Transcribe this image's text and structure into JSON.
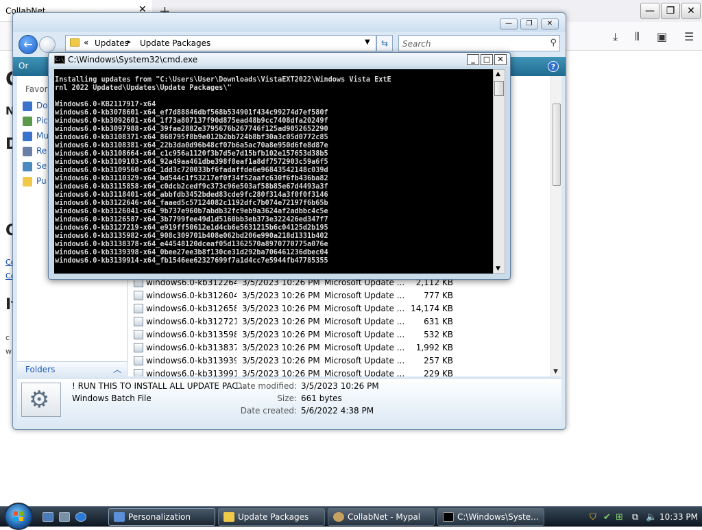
{
  "browser": {
    "tab_title": "CollabNet",
    "tab_close": "✕",
    "new_tab": "+",
    "window_controls": [
      "—",
      "❐",
      "✕"
    ],
    "toolbar_icons": [
      "download-icon",
      "library-icon",
      "sidebar-icon",
      "menu-icon"
    ],
    "page_fragments": [
      "C",
      "N",
      "D",
      "C",
      "It"
    ],
    "page_link_fragments": [
      "Cc",
      "Cc"
    ],
    "page_text_fragments": [
      "c",
      "w"
    ]
  },
  "explorer": {
    "window_controls": [
      "—",
      "❐",
      "✕"
    ],
    "address": {
      "overflow": "«",
      "crumb1": "Updates",
      "crumb2": "Update Packages"
    },
    "search_placeholder": "Search",
    "command_bar": {
      "organize_label": "Or",
      "help_label": "?"
    },
    "nav_pane": {
      "favorites_header": "Favori",
      "items": [
        {
          "label": "Do",
          "color": "#3a73c9"
        },
        {
          "label": "Pic",
          "color": "#5a9a4a"
        },
        {
          "label": "Mu",
          "color": "#3a73c9"
        },
        {
          "label": "Re",
          "color": "#6a7fa8"
        },
        {
          "label": "Se",
          "color": "#4a8ac0"
        },
        {
          "label": "Pu",
          "color": "#f0c84a"
        }
      ],
      "folders_label": "Folders"
    },
    "files": [
      {
        "name": "windows6.0-kb312264...",
        "date": "3/5/2023 10:26 PM",
        "type": "Microsoft Update ...",
        "size": "2,112 KB"
      },
      {
        "name": "windows6.0-kb312604...",
        "date": "3/5/2023 10:26 PM",
        "type": "Microsoft Update ...",
        "size": "777 KB"
      },
      {
        "name": "windows6.0-kb312658...",
        "date": "3/5/2023 10:26 PM",
        "type": "Microsoft Update ...",
        "size": "14,174 KB"
      },
      {
        "name": "windows6.0-kb312721...",
        "date": "3/5/2023 10:26 PM",
        "type": "Microsoft Update ...",
        "size": "631 KB"
      },
      {
        "name": "windows6.0-kb313598...",
        "date": "3/5/2023 10:26 PM",
        "type": "Microsoft Update ...",
        "size": "532 KB"
      },
      {
        "name": "windows6.0-kb313837...",
        "date": "3/5/2023 10:26 PM",
        "type": "Microsoft Update ...",
        "size": "1,992 KB"
      },
      {
        "name": "windows6.0-kb313939...",
        "date": "3/5/2023 10:26 PM",
        "type": "Microsoft Update ...",
        "size": "257 KB"
      },
      {
        "name": "windows6.0-kb313991...",
        "date": "3/5/2023 10:26 PM",
        "type": "Microsoft Update ...",
        "size": "229 KB"
      }
    ],
    "details": {
      "name": "! RUN THIS TO INSTALL ALL UPDATE PAC...",
      "type": "Windows Batch File",
      "date_modified_label": "Date modified:",
      "date_modified": "3/5/2023 10:26 PM",
      "size_label": "Size:",
      "size": "661 bytes",
      "date_created_label": "Date created:",
      "date_created": "5/6/2022 4:38 PM"
    }
  },
  "cmd": {
    "title": "C:\\Windows\\System32\\cmd.exe",
    "icon_text": "C:\\",
    "window_controls": [
      "_",
      "□",
      "✕"
    ],
    "lines": [
      "Installing updates from \"C:\\Users\\User\\Downloads\\VistaEXT2022\\Windows Vista ExtE",
      "rnl 2022 Updated\\Updates\\Update Packages\\\"",
      "",
      "Windows6.0-KB2117917-x64",
      "windows6.0-kb3078601-x64_ef7d88846dbf568b534901f434c99274d7ef580f",
      "windows6.0-kb3092601-x64_1f73a807137f90d875ead48b9cc7408dfa20249f",
      "windows6.0-kb3097988-x64_39fae2882e3795676b267746f125ad9052652290",
      "windows6.0-kb3108371-x64_868795f8b9e012b2bb724b8bf30a3c05d0772c85",
      "windows6.0-kb3108381-x64_22b3da0d96b48cf07b6a5ac70a8e950d6fe8d87e",
      "windows6.0-kb3108664-x64_c1c956a1120f3b7d5e7d15bfb102e157653d38b5",
      "windows6.0-kb3109103-x64_92a49aa461dbe398f8eaf1a8df7572903c59a6f5",
      "windows6.0-kb3109560-x64_1dd3c720033bf6fadaffde6e96843542148c039d",
      "windows6.0-kb3110329-x64_bd544c1f53217ef0f34f52aafc630f6fb436ba82",
      "windows6.0-kb3115858-x64_c0dcb2cedf9c373c96e503af58b85e67d4493a3f",
      "windows6.0-kb3118401-x64_abbfdb3452bded83cde9fc280f314a3f0f0f3146",
      "windows6.0-kb3122646-x64_faaed5c57124082c1192dfc7b074e72197f6b65b",
      "windows6.0-kb3126041-x64_9b737e960b7abdb32fc9eb9a3624af2adbbc4c5e",
      "windows6.0-kb3126587-x64_3b7799fee49d1d5160bb3eb373e322426ed347f7",
      "windows6.0-kb3127219-x64_e919ff50612e1d4cb6e5631215b6c04125d2b195",
      "windows6.0-kb3135982-x64_908c309701b408e062bd206e990a218d1331b402",
      "windows6.0-kb3138378-x64_e44548120dceaf05d1362570a8970770775a076e",
      "windows6.0-kb3139398-x64_0bee27ee3b8f130ce31d292ba706461236dbec04",
      "windows6.0-kb3139914-x64_fb1546ee62327699f7a1d4cc7e5944fb47785355"
    ]
  },
  "taskbar": {
    "buttons": [
      {
        "label": "Personalization",
        "icon_color": "#5b8fd8",
        "active": true
      },
      {
        "label": "Update Packages",
        "icon_color": "#f0c84a",
        "active": false
      },
      {
        "label": "CollabNet - Mypal",
        "icon_color": "#c8a060",
        "active": false
      },
      {
        "label": "C:\\Windows\\Syste...",
        "icon_color": "#000000",
        "active": false
      }
    ],
    "clock": "10:33 PM"
  }
}
